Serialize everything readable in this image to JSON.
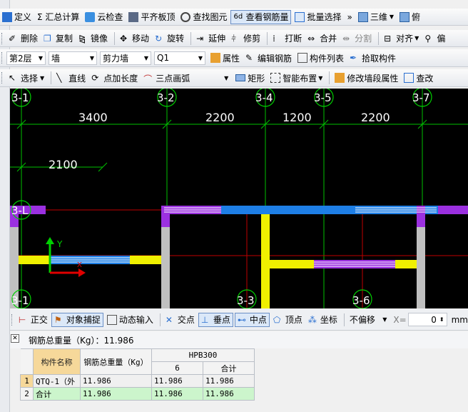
{
  "menu_row": {
    "items": [
      "定义",
      "Σ 汇总计算",
      "云检查",
      "平齐板顶",
      "查找图元",
      "查看钢筋量",
      "批量选择",
      "三维",
      "俯"
    ],
    "overflow": "»",
    "view_select": "三维"
  },
  "edit_row": {
    "items": [
      "删除",
      "复制",
      "镜像",
      "移动",
      "旋转",
      "延伸",
      "修剪",
      "打断",
      "合并",
      "分割",
      "对齐",
      "偏"
    ]
  },
  "layer_row": {
    "floor": "第2层",
    "category": "墙",
    "type": "剪力墙",
    "member": "Q1",
    "actions": [
      "属性",
      "编辑钢筋",
      "构件列表",
      "拾取构件"
    ]
  },
  "draw_row": {
    "select": "选择",
    "tools": [
      "直线",
      "点加长度",
      "三点画弧",
      "矩形",
      "智能布置",
      "修改墙段属性",
      "查改"
    ]
  },
  "drawing": {
    "axis_labels_top": [
      "3-1",
      "3-2",
      "3-4",
      "3-5",
      "3-7"
    ],
    "axis_labels_bottom": [
      "3-1",
      "3-3",
      "3-6"
    ],
    "axis_label_left": "3-L",
    "dimensions": [
      "3400",
      "2200",
      "1200",
      "2200"
    ],
    "dimension_lower": "2100",
    "ucs_y": "Y",
    "ucs_x": "X"
  },
  "snap_bar": {
    "items": [
      "正交",
      "对象捕捉",
      "动态输入",
      "交点",
      "垂点",
      "中点",
      "顶点",
      "坐标"
    ],
    "offset_mode": "不偏移",
    "x_label": "X=",
    "x_value": "0",
    "unit": "mm"
  },
  "rebar_panel": {
    "total_label": "钢筋总重量（Kg）：11.986",
    "col_member": "构件名称",
    "col_total": "钢筋总重量（Kg）",
    "group": "HPB300",
    "col_dia": "6",
    "col_sum": "合计",
    "rows": [
      {
        "n": "1",
        "name": "QTQ-1（外",
        "total": "11.986",
        "d6": "11.986",
        "sum": "11.986"
      },
      {
        "n": "2",
        "name": "合计",
        "total": "11.986",
        "d6": "11.986",
        "sum": "11.986"
      }
    ]
  },
  "colors": {
    "wall_gray": "#c0c0c0",
    "wall_blue": "#1e7fe6",
    "wall_purple": "#9b30e0",
    "wall_yellow": "#f0f000",
    "axis_green": "#00d000",
    "red_line": "#d00000"
  }
}
